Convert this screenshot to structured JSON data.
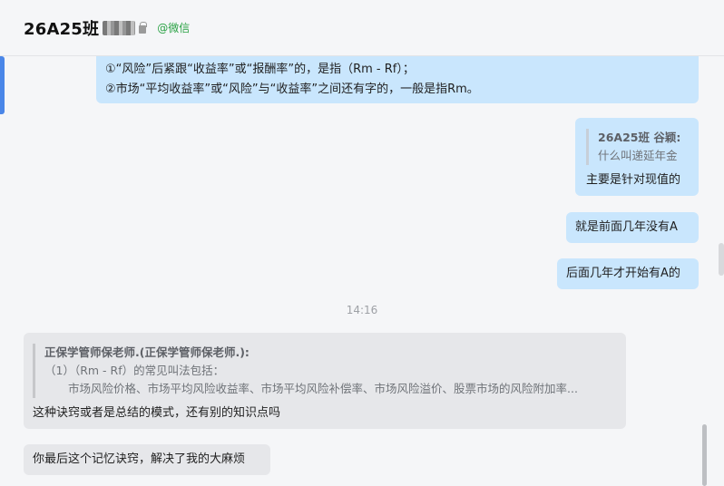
{
  "header": {
    "title": "26A25班",
    "source_tag": "@微信"
  },
  "messages": [
    {
      "lines": [
        "①“风险”后紧跟“收益率”或“报酬率”的，是指（Rm - Rf）；",
        "②市场“平均收益率”或“风险”与“收益率”之间还有字的，一般是指Rm。"
      ]
    },
    {
      "quote_author": "26A25班 谷颖:",
      "quote_text": "什么叫递延年金",
      "text": "主要是针对现值的"
    },
    {
      "text": "就是前面几年没有A"
    },
    {
      "text": "后面几年才开始有A的"
    },
    {
      "time": "14:16"
    },
    {
      "quote_author": "正保学管师保老师.(正保学管师保老师.):",
      "quote_line1": "（1）（Rm - Rf）的常见叫法包括：",
      "quote_line2": "市场风险价格、市场平均风险收益率、市场平均风险补偿率、市场风险溢价、股票市场的风险附加率...",
      "text": "这种诀窍或者是总结的模式，还有别的知识点吗"
    },
    {
      "text": "你最后这个记忆诀窍，解决了我的大麻烦"
    }
  ],
  "colors": {
    "outgoing_bubble": "#c9e6fd",
    "incoming_bubble": "#e6e7ea",
    "wechat_green": "#2ba245",
    "accent": "#4a86e8"
  }
}
